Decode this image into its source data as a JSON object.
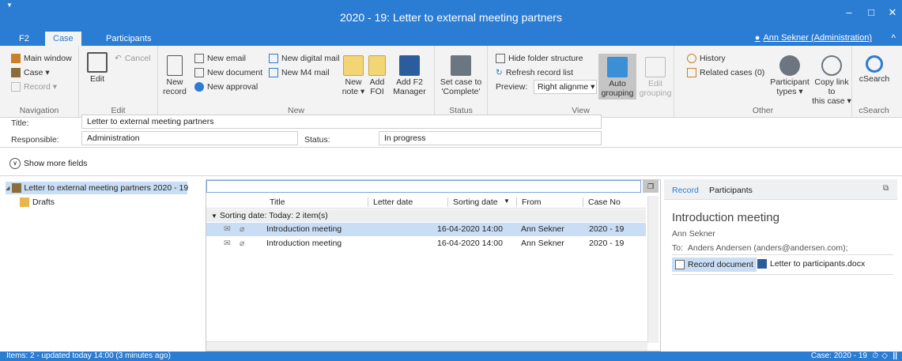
{
  "window": {
    "title": "2020 - 19: Letter to external meeting partners",
    "minimize": "–",
    "maximize": "□",
    "close": "✕",
    "quick_access": "▼"
  },
  "tabs": [
    {
      "label": "F2"
    },
    {
      "label": "Case"
    },
    {
      "label": "Participants"
    }
  ],
  "user": {
    "label": "Ann Sekner (Administration)"
  },
  "collapse": "^",
  "ribbon": {
    "navigation": {
      "main_window": "Main window",
      "case": "Case ▾",
      "record": "Record ▾",
      "label": "Navigation"
    },
    "edit": {
      "edit": "Edit",
      "cancel": "Cancel",
      "label": "Edit"
    },
    "new": {
      "new_record_1": "New",
      "new_record_2": "record",
      "new_email": "New email",
      "new_document": "New document",
      "new_approval": "New approval",
      "new_digital_mail": "New digital mail",
      "new_m4_mail": "New M4 mail",
      "new_note_1": "New",
      "new_note_2": "note ▾",
      "add_foi_1": "Add",
      "add_foi_2": "FOI",
      "add_f2_1": "Add F2",
      "add_f2_2": "Manager",
      "label": "New"
    },
    "status": {
      "set_1": "Set case to",
      "set_2": "'Complete'",
      "label": "Status"
    },
    "view": {
      "hide_folder": "Hide folder structure",
      "refresh": "Refresh record list",
      "preview_label": "Preview:",
      "preview_value": "Right alignme ▾",
      "auto_1": "Auto",
      "auto_2": "grouping",
      "edit_grp_1": "Edit",
      "edit_grp_2": "grouping",
      "label": "View"
    },
    "other": {
      "history": "History",
      "related": "Related cases (0)",
      "ptypes_1": "Participant",
      "ptypes_2": "types ▾",
      "copy_1": "Copy link to",
      "copy_2": "this case ▾",
      "label": "Other"
    },
    "csearch": {
      "btn": "cSearch",
      "label": "cSearch"
    }
  },
  "fields": {
    "title_label": "Title:",
    "title_value": "Letter to external meeting partners",
    "responsible_label": "Responsible:",
    "responsible_value": "Administration",
    "status_label": "Status:",
    "status_value": "In progress",
    "show_more": "Show more fields"
  },
  "tree": {
    "root": "Letter to external meeting partners 2020 - 19",
    "child": "Drafts"
  },
  "grid": {
    "columns": [
      "Title",
      "Letter date",
      "Sorting date",
      "From",
      "Case No"
    ],
    "group": "Sorting date: Today: 2 item(s)",
    "rows": [
      {
        "title": "Introduction meeting",
        "letter_date": "",
        "sorting_date": "16-04-2020 14:00",
        "from": "Ann Sekner",
        "case_no": "2020 - 19"
      },
      {
        "title": "Introduction meeting",
        "letter_date": "",
        "sorting_date": "16-04-2020 14:00",
        "from": "Ann Sekner",
        "case_no": "2020 - 19"
      }
    ]
  },
  "preview": {
    "tab_record": "Record",
    "tab_participants": "Participants",
    "subject": "Introduction meeting",
    "sender": "Ann Sekner",
    "to_label": "To:",
    "to_value": "Anders Andersen (anders@andersen.com);",
    "attach_record": "Record document",
    "attach_file": "Letter to participants.docx"
  },
  "status": {
    "left": "Items: 2 - updated today 14:00 (3 minutes ago)",
    "right": "Case: 2020 - 19"
  }
}
